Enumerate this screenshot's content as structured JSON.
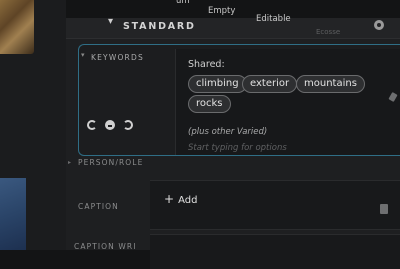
{
  "toolbar": {
    "items": [
      {
        "label": "um"
      },
      {
        "label": "Empty"
      },
      {
        "label": "Editable"
      },
      {
        "label": "Ecosse"
      }
    ]
  },
  "section": {
    "title": "STANDARD"
  },
  "keywords": {
    "label": "KEYWORDS",
    "shared_label": "Shared:",
    "chips": [
      "climbing",
      "exterior",
      "mountains",
      "rocks"
    ],
    "other_varied": "(plus other Varied)",
    "placeholder": "Start typing for options"
  },
  "fields": {
    "person_role": "PERSON/ROLE",
    "caption": "CAPTION",
    "caption_writer": "CAPTION WRI",
    "add_label": "Add"
  },
  "colors": {
    "accent_outline": "#2f6e86"
  }
}
